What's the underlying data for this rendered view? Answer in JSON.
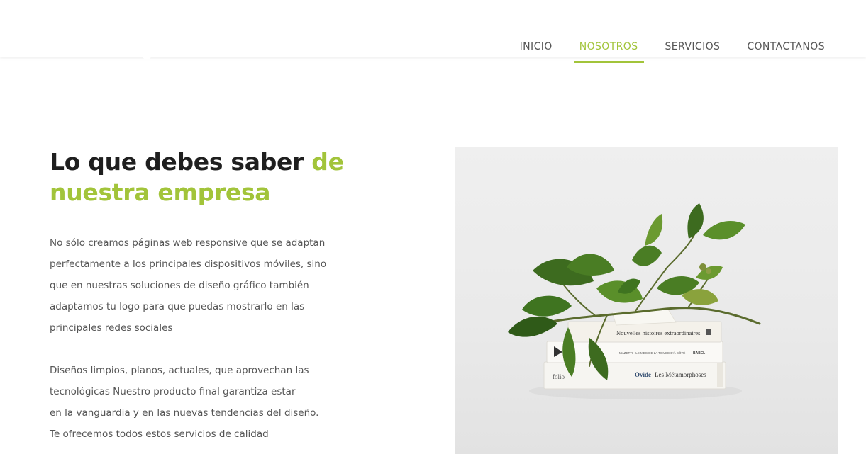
{
  "nav": {
    "items": [
      {
        "label": "INICIO"
      },
      {
        "label": "NOSOTROS"
      },
      {
        "label": "SERVICIOS"
      },
      {
        "label": "CONTACTANOS"
      }
    ],
    "active": "NOSOTROS"
  },
  "main": {
    "heading": {
      "part1": "Lo que debes saber ",
      "accent1": "de",
      "accent2": "nuestra empresa"
    },
    "paragraph1": [
      "No sólo creamos páginas web responsive que se adaptan",
      "perfectamente a los principales dispositivos móviles, sino",
      "que en nuestras soluciones de diseño gráfico también",
      "adaptamos tu logo para que puedas mostrarlo en las",
      "principales redes sociales"
    ],
    "paragraph2": [
      "Diseños limpios, planos, actuales, que aprovechan las",
      "tecnológicas Nuestro producto final garantiza estar",
      "en la vanguardia y en las nuevas tendencias del diseño.",
      "Te ofrecemos todos estos servicios de calidad"
    ],
    "photo": {
      "book1": "Nouvelles histoires extraordinaires",
      "book2": "MAZETTI · LE MEC DE LA TOMBE D'À CÔTÉ",
      "book2_brand": "BABEL",
      "book3_brand": "folio",
      "book3_author": "Ovide",
      "book3_title": "Les Métamorphoses"
    }
  },
  "colors": {
    "accent": "#a2c43a",
    "heading": "#1f1f1f",
    "text": "#555555"
  }
}
